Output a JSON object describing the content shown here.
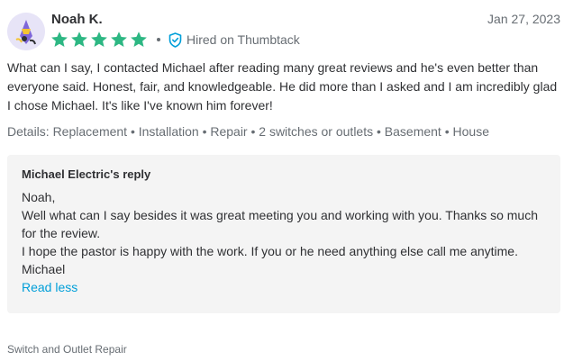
{
  "review": {
    "author": "Noah K.",
    "date": "Jan 27, 2023",
    "rating": 5,
    "rating_max": 5,
    "hired_badge": "Hired on Thumbtack",
    "body": "What can I say, I contacted Michael after reading many great reviews and he's even better than everyone said. Honest, fair, and knowledgeable. He did more than I asked and I am incredibly glad I chose Michael. It's like I've known him forever!",
    "details": "Details: Replacement • Installation • Repair • 2 switches or outlets • Basement • House",
    "icons": {
      "avatar": "avatar-illustration",
      "star": "star-icon",
      "hired": "shield-check-icon"
    },
    "colors": {
      "star": "#2db783",
      "hired_icon": "#009fd9",
      "link": "#009fd9"
    }
  },
  "reply": {
    "title": "Michael Electric's reply",
    "lines": [
      "Noah,",
      "Well what can I say besides it was great meeting you and working with you. Thanks so much for the review.",
      "I hope the pastor is happy with the work. If you or he need anything else call me anytime.",
      "Michael"
    ],
    "read_less_label": "Read less"
  },
  "category": "Switch and Outlet Repair"
}
